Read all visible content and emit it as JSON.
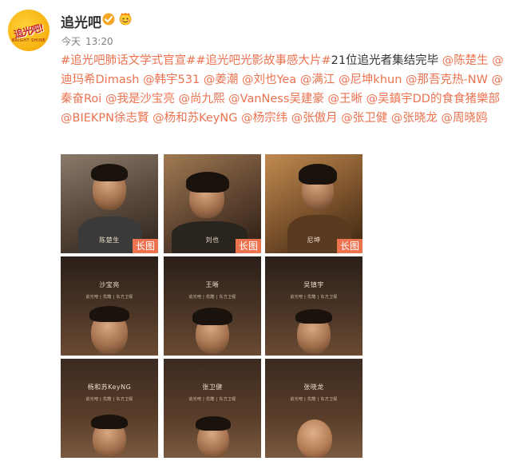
{
  "account": {
    "avatar_text": "追光吧!",
    "avatar_sub": "BRIGHT·SHINE",
    "name": "追光吧",
    "post_date": "今天",
    "post_time": "13:20"
  },
  "post": {
    "tags": [
      "#追光吧肺话文学式官宣#",
      "#追光吧光影故事感大片#"
    ],
    "headline": "21位追光者集结完毕",
    "mentions": [
      "@陈楚生",
      "@迪玛希Dimash",
      "@韩宇531",
      "@姜潮",
      "@刘也Yea",
      "@满江",
      "@尼坤khun",
      "@那吾克热-NW",
      "@秦奋Roi",
      "@我是沙宝亮",
      "@尚九熙",
      "@VanNess吴建豪",
      "@王晰",
      "@吴鎮宇DD的食食猪樂部",
      "@BIEKPN徐志賢",
      "@杨和苏KeyNG",
      "@杨宗纬",
      "@张傲月",
      "@张卫健",
      "@张晓龙",
      "@周晓鸥"
    ]
  },
  "images": {
    "long_label": "长图",
    "cells": [
      {
        "name": "陈楚生",
        "long": true
      },
      {
        "name": "刘也",
        "long": true
      },
      {
        "name": "尼坤",
        "long": true
      },
      {
        "name": "沙宝亮",
        "long": false
      },
      {
        "name": "王晰",
        "long": false
      },
      {
        "name": "吴镇宇",
        "long": false
      },
      {
        "name": "杨和苏KeyNG",
        "long": false
      },
      {
        "name": "张卫健",
        "long": false
      },
      {
        "name": "张晓龙",
        "long": false
      }
    ],
    "logo_text": "追光吧 | 优酷 | 东方卫视"
  },
  "colors": {
    "link": "#eb7350",
    "verified": "#f5a623"
  }
}
